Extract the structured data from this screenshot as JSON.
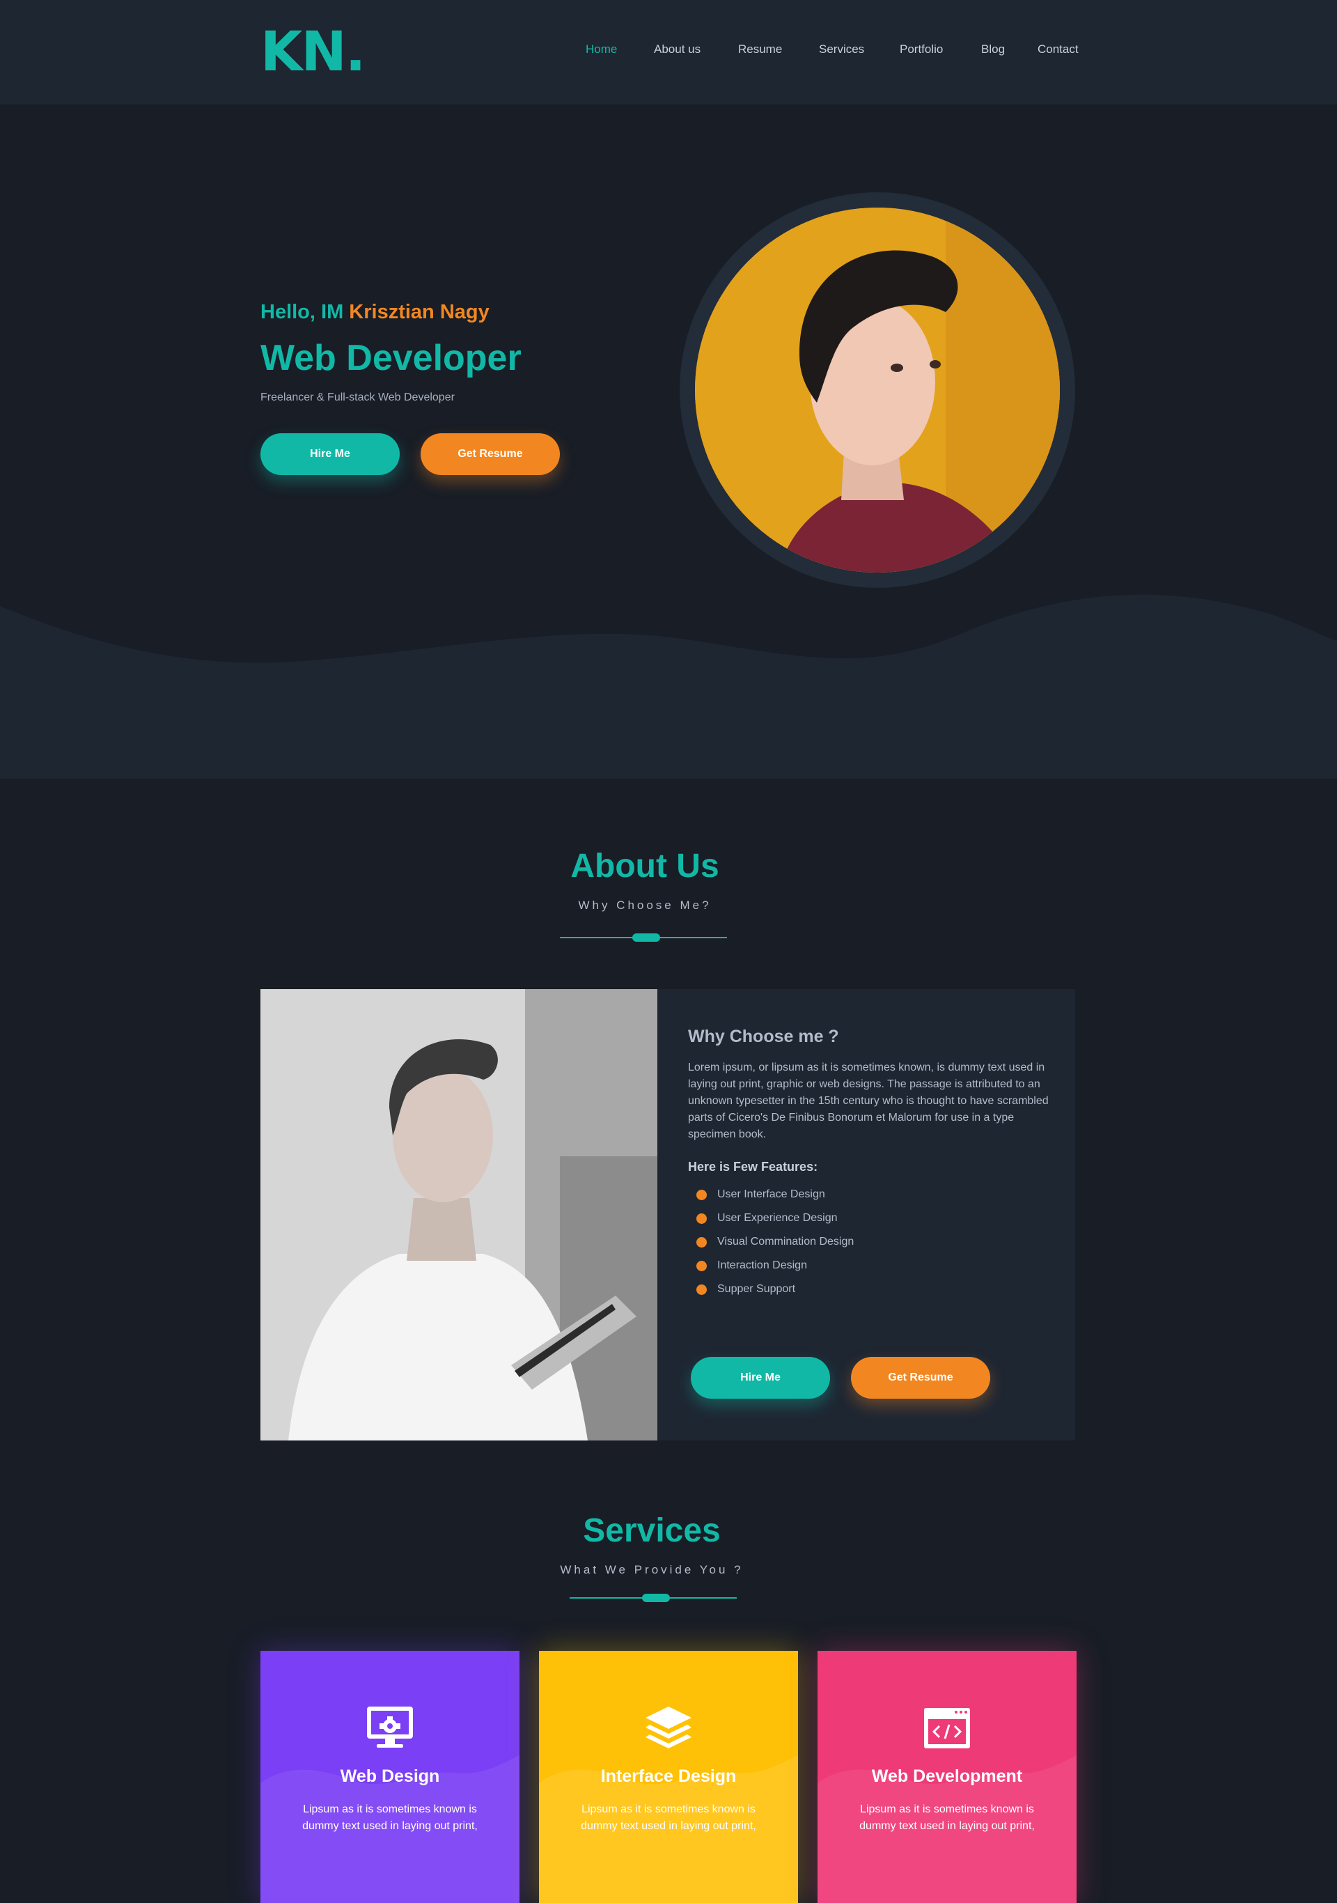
{
  "brand": {
    "logo": "KN."
  },
  "nav": {
    "items": [
      {
        "label": "Home",
        "active": true
      },
      {
        "label": "About us",
        "active": false
      },
      {
        "label": "Resume",
        "active": false
      },
      {
        "label": "Services",
        "active": false
      },
      {
        "label": "Portfolio",
        "active": false
      },
      {
        "label": "Blog",
        "active": false
      },
      {
        "label": "Contact",
        "active": false
      }
    ]
  },
  "hero": {
    "greeting": "Hello, IM",
    "name": "Krisztian Nagy",
    "title": "Web Developer",
    "subtitle": "Freelancer & Full-stack Web Developer",
    "hire_label": "Hire Me",
    "resume_label": "Get Resume"
  },
  "about": {
    "heading": "About Us",
    "subheading": "Why Choose Me?",
    "card_title": "Why Choose me ?",
    "body": "Lorem ipsum, or lipsum as it is sometimes known, is dummy text used in laying out print, graphic or web designs. The passage is attributed to an unknown typesetter in the 15th century who is thought to have scrambled parts of Cicero's De Finibus Bonorum et Malorum for use in a type specimen book.",
    "features_title": "Here is Few Features:",
    "features": [
      "User Interface Design",
      "User Experience Design",
      "Visual  Commination Design",
      "Interaction Design",
      "Supper Support"
    ],
    "hire_label": "Hire Me",
    "resume_label": "Get Resume"
  },
  "services": {
    "heading": "Services",
    "subheading": "What We Provide You ?",
    "cards": [
      {
        "title": "Web Design",
        "text": "Lipsum as it is sometimes known is dummy text used in laying out print,",
        "icon": "monitor-gear-icon",
        "color": "#7b3ff5"
      },
      {
        "title": "Interface Design",
        "text": "Lipsum as it is sometimes known is dummy text used in laying out print,",
        "icon": "layers-icon",
        "color": "#ffc107"
      },
      {
        "title": "Web Development",
        "text": "Lipsum as it is sometimes known is dummy text used in laying out print,",
        "icon": "code-window-icon",
        "color": "#ef3a78"
      }
    ]
  },
  "colors": {
    "accent": "#12b8a6",
    "secondary": "#f28722",
    "background": "#181d26",
    "panel": "#1e2632"
  }
}
